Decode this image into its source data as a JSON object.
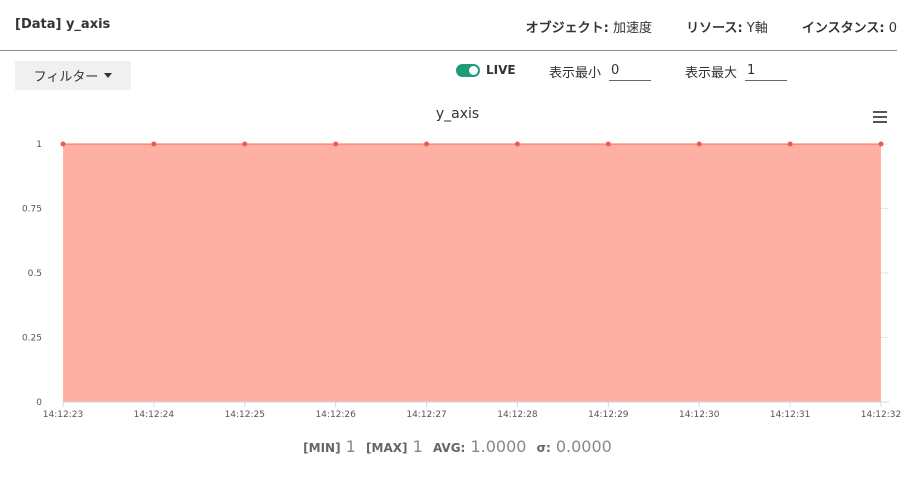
{
  "header": {
    "title": "[Data] y_axis",
    "object_label": "オブジェクト:",
    "object_value": "加速度",
    "resource_label": "リソース:",
    "resource_value": "Y軸",
    "instance_label": "インスタンス:",
    "instance_value": "0"
  },
  "controls": {
    "filter_label": "フィルター",
    "live_label": "LIVE",
    "live_on": true,
    "min_label": "表示最小",
    "min_value": "0",
    "max_label": "表示最大",
    "max_value": "1"
  },
  "chart_data": {
    "type": "area",
    "title": "y_axis",
    "x": [
      "14:12:23",
      "14:12:24",
      "14:12:25",
      "14:12:26",
      "14:12:27",
      "14:12:28",
      "14:12:29",
      "14:12:30",
      "14:12:31",
      "14:12:32"
    ],
    "values": [
      1,
      1,
      1,
      1,
      1,
      1,
      1,
      1,
      1,
      1
    ],
    "ylim": [
      0,
      1
    ],
    "yticks": [
      "0",
      "0.25",
      "0.5",
      "0.75",
      "1"
    ],
    "grid": true,
    "colors": {
      "fill": "#ffb0a5",
      "line": "#f07060",
      "point": "#f2594b"
    }
  },
  "stats": {
    "min_label": "[MIN]",
    "min_value": "1",
    "max_label": "[MAX]",
    "max_value": "1",
    "avg_label": "AVG:",
    "avg_value": "1.0000",
    "sigma_label": "σ:",
    "sigma_value": "0.0000"
  }
}
